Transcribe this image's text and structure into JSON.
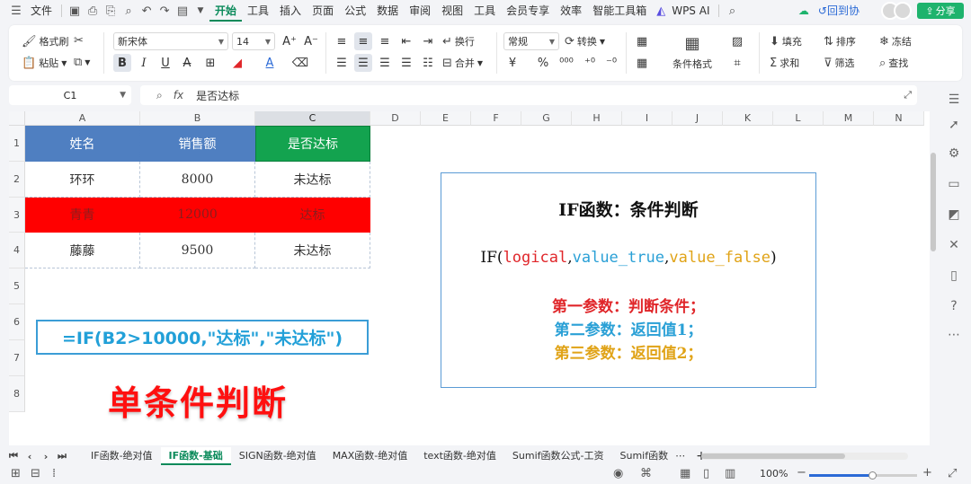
{
  "menubar": {
    "file_label": "文件",
    "tabs": [
      "开始",
      "工具",
      "插入",
      "页面",
      "公式",
      "数据",
      "审阅",
      "视图",
      "工具",
      "会员专享",
      "效率",
      "智能工具箱"
    ],
    "active_tab": "开始",
    "wps_ai": "WPS AI",
    "collab": "回到协",
    "share": "分享"
  },
  "ribbon": {
    "format_painter": "格式刷",
    "paste": "粘贴",
    "font_name": "新宋体",
    "font_size": "14",
    "wrap": "换行",
    "merge": "合并",
    "number_format": "常规",
    "convert": "转换",
    "cond_format": "条件格式",
    "fill": "填充",
    "sort": "排序",
    "freeze": "冻结",
    "sum": "求和",
    "filter": "筛选",
    "find": "查找"
  },
  "formula_bar": {
    "cell_ref": "C1",
    "fx": "fx",
    "content": "是否达标"
  },
  "sheet": {
    "columns": [
      "A",
      "B",
      "C",
      "D",
      "E",
      "F",
      "G",
      "H",
      "I",
      "J",
      "K",
      "L",
      "M",
      "N"
    ],
    "selected_column": "C",
    "rows": [
      "1",
      "2",
      "3",
      "4",
      "5",
      "6",
      "7",
      "8"
    ],
    "table": {
      "headers": [
        "姓名",
        "销售额",
        "是否达标"
      ],
      "data": [
        [
          "环环",
          "8000",
          "未达标"
        ],
        [
          "青青",
          "12000",
          "达标"
        ],
        [
          "藤藤",
          "9500",
          "未达标"
        ]
      ]
    },
    "formula_text": "=IF(B2>10000,\"达标\",\"未达标\")",
    "big_title": "单条件判断",
    "info": {
      "title": "IF函数：条件判断",
      "syntax_fn": "IF(",
      "syntax_p1": "logical",
      "syntax_p2": "value_true",
      "syntax_p3": "value_false",
      "syntax_comma": ",",
      "syntax_close": ")",
      "line1": "第一参数：判断条件；",
      "line2": "第二参数：返回值1；",
      "line3": "第三参数：返回值2；"
    }
  },
  "tabs": {
    "sheets": [
      "IF函数-绝对值",
      "IF函数-基础",
      "SIGN函数-绝对值",
      "MAX函数-绝对值",
      "text函数-绝对值",
      "Sumif函数公式-工资",
      "Sumif函数"
    ],
    "active": "IF函数-基础",
    "add": "+",
    "more": "⋯"
  },
  "status": {
    "zoom": "100%"
  },
  "colors": {
    "accent": "#0a8a5a",
    "header_blue": "#4f7fc1",
    "header_green": "#13a34f",
    "highlight_red": "#ff0000",
    "formula_blue": "#22a0d8",
    "title_red": "#ff1010"
  }
}
